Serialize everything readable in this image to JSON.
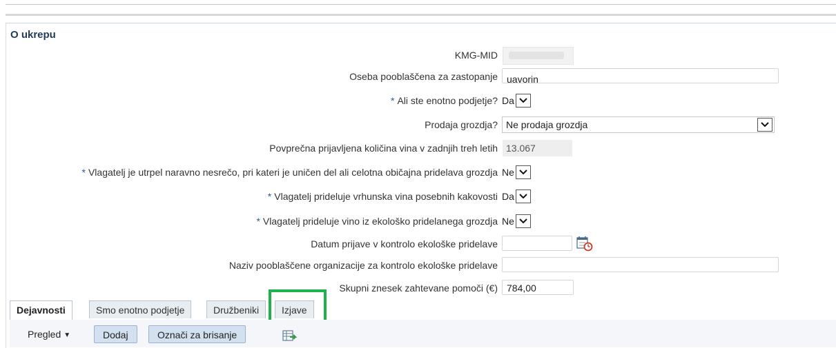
{
  "section_title": "O ukrepu",
  "fields": {
    "kmg_mid": {
      "label": "KMG-MID"
    },
    "oseba": {
      "label": "Oseba pooblaščena za zastopanje",
      "value": "uavorin"
    },
    "enotno_podjetje": {
      "label": "Ali ste enotno podjetje?",
      "value": "Da",
      "required": true
    },
    "prodaja_grozdja": {
      "label": "Prodaja grozdja?",
      "value": "Ne prodaja grozdja"
    },
    "povprecna_kolicina": {
      "label": "Povprečna prijavljena količina vina v zadnjih treh letih",
      "value": "13.067"
    },
    "naravna_nesreca": {
      "label": "Vlagatelj je utrpel naravno nesrečo, pri kateri je uničen del ali celotna običajna pridelava grozdja",
      "value": "Ne",
      "required": true
    },
    "vrhunska_vina": {
      "label": "Vlagatelj prideluje vrhunska vina posebnih kakovosti",
      "value": "Da",
      "required": true
    },
    "ekolosko": {
      "label": "Vlagatelj prideluje vino iz ekološko pridelanega grozdja",
      "value": "Ne",
      "required": true
    },
    "datum_prijave": {
      "label": "Datum prijave v kontrolo ekološke pridelave",
      "value": ""
    },
    "naziv_organizacije": {
      "label": "Naziv pooblaščene organizacije za kontrolo ekološke pridelave",
      "value": ""
    },
    "skupni_znesek": {
      "label": "Skupni znesek zahtevane pomoči (€)",
      "value": "784,00"
    }
  },
  "required_marker": "*",
  "tabs": [
    {
      "label": "Dejavnosti",
      "active": true
    },
    {
      "label": "Smo enotno podjetje",
      "active": false
    },
    {
      "label": "Družbeniki",
      "active": false
    },
    {
      "label": "Izjave",
      "active": false
    }
  ],
  "toolbar": {
    "pregled_label": "Pregled",
    "dodaj_label": "Dodaj",
    "oznaci_label": "Označi za brisanje"
  },
  "icons": {
    "calendar": "calendar-icon",
    "dropdown": "chevron-down-icon",
    "export": "export-icon"
  },
  "colors": {
    "highlight": "#1db34a",
    "section_title": "#1f3a5a",
    "required_star": "#2a5b9b",
    "button_bg": "#d3e0ef"
  }
}
